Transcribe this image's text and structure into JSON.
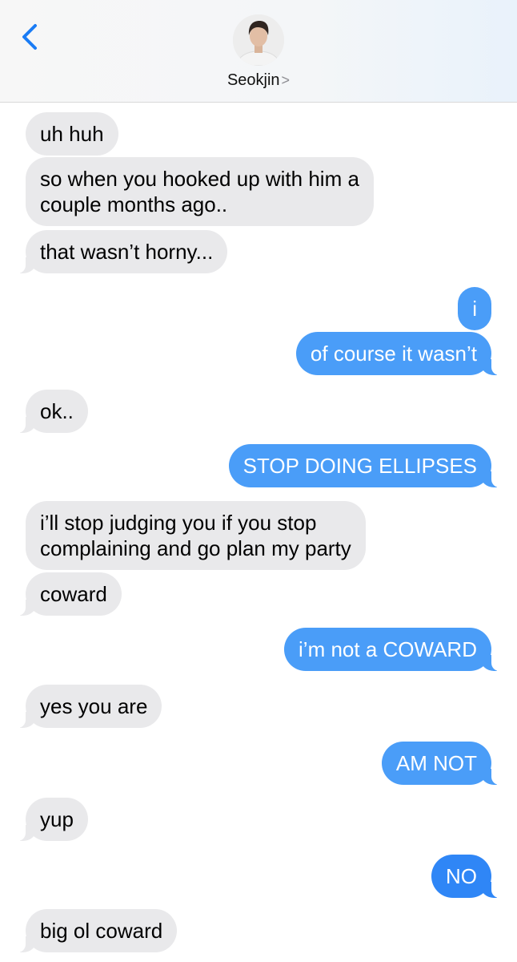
{
  "header": {
    "contact_name": "Seokjin",
    "contact_chevron": ">",
    "back_icon": "chevron-left-icon",
    "avatar_icon": "contact-photo"
  },
  "colors": {
    "incoming_bubble": "#e9e9eb",
    "outgoing_bubble": "#4a9df8",
    "outgoing_bubble_latest": "#2f86f6",
    "back_arrow": "#1a7cf5"
  },
  "messages": [
    {
      "from": "them",
      "text": "uh huh"
    },
    {
      "from": "them",
      "text": "so when you hooked up with him a\ncouple months ago.."
    },
    {
      "from": "them",
      "text": "that wasn’t horny..."
    },
    {
      "from": "me",
      "text": "i"
    },
    {
      "from": "me",
      "text": "of course it wasn’t"
    },
    {
      "from": "them",
      "text": "ok.."
    },
    {
      "from": "me",
      "text": "STOP DOING ELLIPSES"
    },
    {
      "from": "them",
      "text": "i’ll stop judging you if you stop\ncomplaining and go plan my party"
    },
    {
      "from": "them",
      "text": "coward"
    },
    {
      "from": "me",
      "text": "i’m not a COWARD"
    },
    {
      "from": "them",
      "text": "yes you are"
    },
    {
      "from": "me",
      "text": "AM NOT"
    },
    {
      "from": "them",
      "text": "yup"
    },
    {
      "from": "me",
      "text": "NO"
    },
    {
      "from": "them",
      "text": "big ol coward"
    }
  ]
}
